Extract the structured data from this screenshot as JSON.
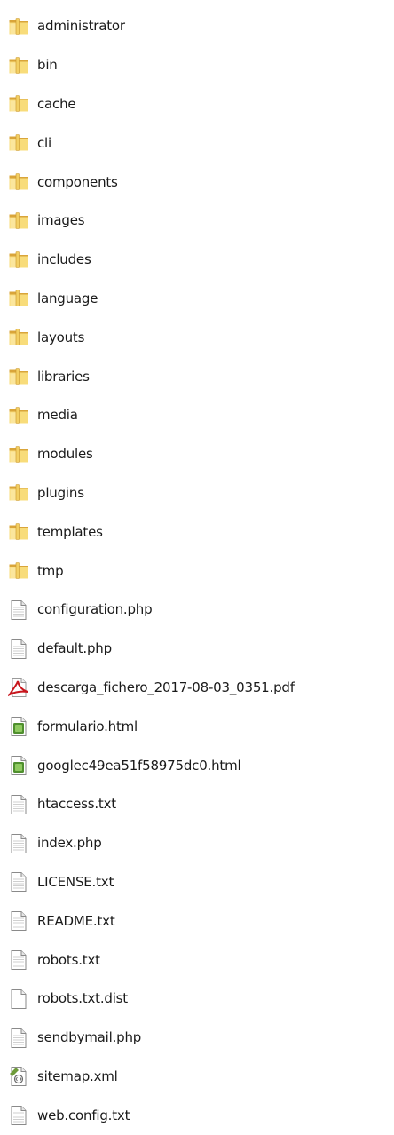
{
  "items": [
    {
      "name": "administrator",
      "type": "folder",
      "icon": "folder-icon"
    },
    {
      "name": "bin",
      "type": "folder",
      "icon": "folder-icon"
    },
    {
      "name": "cache",
      "type": "folder",
      "icon": "folder-icon"
    },
    {
      "name": "cli",
      "type": "folder",
      "icon": "folder-icon"
    },
    {
      "name": "components",
      "type": "folder",
      "icon": "folder-icon"
    },
    {
      "name": "images",
      "type": "folder",
      "icon": "folder-icon"
    },
    {
      "name": "includes",
      "type": "folder",
      "icon": "folder-icon"
    },
    {
      "name": "language",
      "type": "folder",
      "icon": "folder-icon"
    },
    {
      "name": "layouts",
      "type": "folder",
      "icon": "folder-icon"
    },
    {
      "name": "libraries",
      "type": "folder",
      "icon": "folder-icon"
    },
    {
      "name": "media",
      "type": "folder",
      "icon": "folder-icon"
    },
    {
      "name": "modules",
      "type": "folder",
      "icon": "folder-icon"
    },
    {
      "name": "plugins",
      "type": "folder",
      "icon": "folder-icon"
    },
    {
      "name": "templates",
      "type": "folder",
      "icon": "folder-icon"
    },
    {
      "name": "tmp",
      "type": "folder",
      "icon": "folder-icon"
    },
    {
      "name": "configuration.php",
      "type": "text",
      "icon": "text-file-icon"
    },
    {
      "name": "default.php",
      "type": "text",
      "icon": "text-file-icon"
    },
    {
      "name": "descarga_fichero_2017-08-03_0351.pdf",
      "type": "pdf",
      "icon": "pdf-file-icon"
    },
    {
      "name": "formulario.html",
      "type": "html",
      "icon": "html-file-icon"
    },
    {
      "name": "googlec49ea51f58975dc0.html",
      "type": "html",
      "icon": "html-file-icon"
    },
    {
      "name": "htaccess.txt",
      "type": "text",
      "icon": "text-file-icon"
    },
    {
      "name": "index.php",
      "type": "text",
      "icon": "text-file-icon"
    },
    {
      "name": "LICENSE.txt",
      "type": "text",
      "icon": "text-file-icon"
    },
    {
      "name": "README.txt",
      "type": "text",
      "icon": "text-file-icon"
    },
    {
      "name": "robots.txt",
      "type": "text",
      "icon": "text-file-icon"
    },
    {
      "name": "robots.txt.dist",
      "type": "blank",
      "icon": "blank-file-icon"
    },
    {
      "name": "sendbymail.php",
      "type": "text",
      "icon": "text-file-icon"
    },
    {
      "name": "sitemap.xml",
      "type": "xml",
      "icon": "xml-file-icon"
    },
    {
      "name": "web.config.txt",
      "type": "text",
      "icon": "text-file-icon"
    }
  ],
  "colors": {
    "folder_light": "#f8dc7a",
    "folder_dark": "#d9a53a",
    "pdf_red": "#c8161d",
    "html_green": "#4f8f2e",
    "xml_green": "#6e9b3a"
  }
}
